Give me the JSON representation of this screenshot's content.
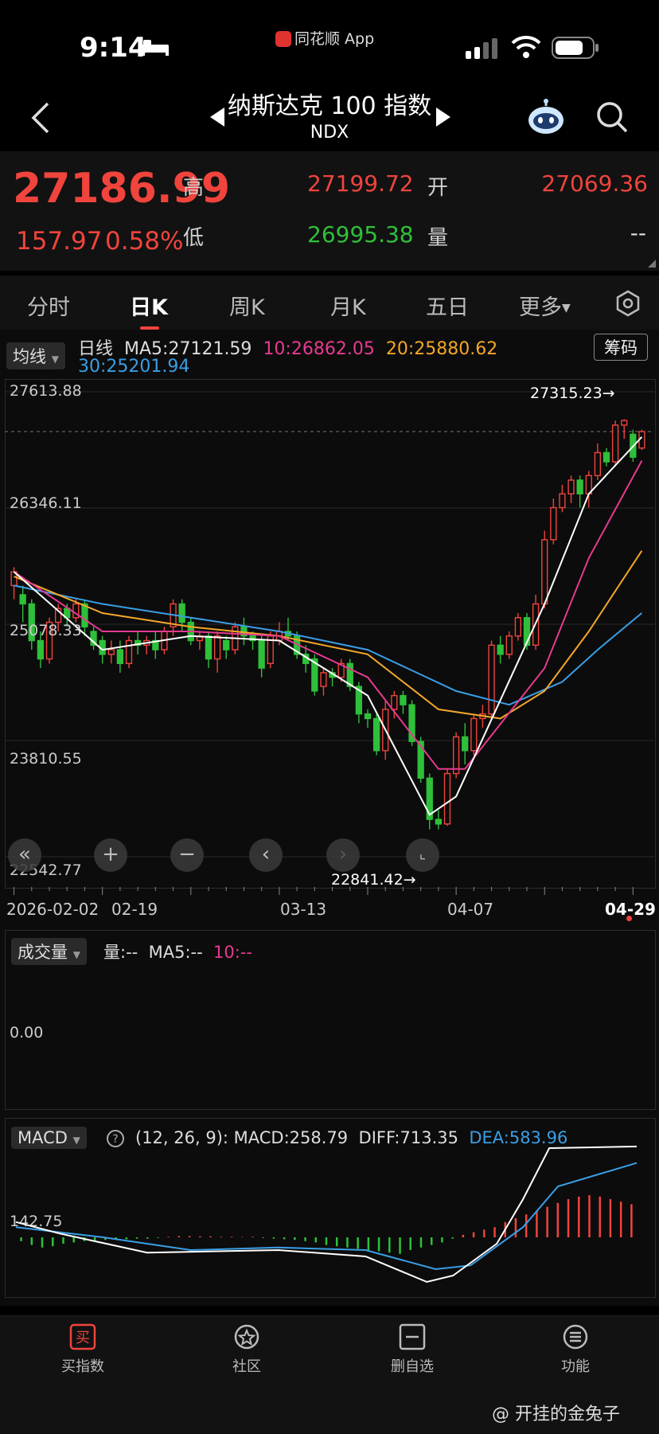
{
  "status": {
    "time": "9:14",
    "app_label": "同花顺 App"
  },
  "header": {
    "title": "纳斯达克 100 指数",
    "subtitle": "NDX"
  },
  "quote": {
    "price": "27186.99",
    "change": "157.97",
    "change_pct": "0.58%",
    "high_label": "高",
    "high": "27199.72",
    "low_label": "低",
    "low": "26995.38",
    "open_label": "开",
    "open": "27069.36",
    "volume_label": "量",
    "volume": "--"
  },
  "tabs": [
    "分时",
    "日K",
    "周K",
    "月K",
    "五日",
    "更多"
  ],
  "active_tab": 1,
  "main_chart": {
    "ma_selector": "均线",
    "legend_prefix": "日线",
    "ma5": "MA5:27121.59",
    "ma10": "10:26862.05",
    "ma20": "20:25880.62",
    "ma30": "30:25201.94",
    "chips_button": "筹码",
    "y_labels": [
      "27613.88",
      "26346.11",
      "25078.33",
      "23810.55",
      "22542.77"
    ],
    "high_marker": "27315.23→",
    "low_marker": "22841.42→",
    "x_labels": [
      "2026-02-02",
      "02-19",
      "03-13",
      "04-07",
      "04-29"
    ],
    "colors": {
      "ma5": "#ffffff",
      "ma10": "#e63a8f",
      "ma20": "#f4a62a",
      "ma30": "#3a9ee6",
      "up": "#f0443d",
      "down": "#2ec03a"
    }
  },
  "volume_panel": {
    "selector": "成交量",
    "vol": "量:--",
    "ma5": "MA5:--",
    "ma10": "10:--",
    "zero": "0.00"
  },
  "macd_panel": {
    "selector": "MACD",
    "params": "(12, 26, 9):",
    "macd": "MACD:258.79",
    "diff": "DIFF:713.35",
    "dea": "DEA:583.96",
    "level": "142.75"
  },
  "bottom_nav": [
    "买指数",
    "社区",
    "删自选",
    "功能"
  ],
  "watermark": "@ 开挂的金兔子",
  "chart_data": {
    "type": "candlestick",
    "x_start": "2026-02-02",
    "x_end": "04-29",
    "ylim": [
      22542.77,
      27613.88
    ],
    "high": 27315.23,
    "low": 22841.42,
    "candles": [
      [
        25500,
        25650,
        25350,
        25700
      ],
      [
        25400,
        25300,
        25100,
        25500
      ],
      [
        25300,
        24900,
        24800,
        25350
      ],
      [
        24900,
        24700,
        24600,
        25000
      ],
      [
        24700,
        25100,
        24650,
        25150
      ],
      [
        25100,
        25250,
        25000,
        25300
      ],
      [
        25250,
        25150,
        25050,
        25300
      ],
      [
        25150,
        25300,
        25100,
        25350
      ],
      [
        25300,
        25050,
        24950,
        25350
      ],
      [
        25000,
        24850,
        24800,
        25050
      ],
      [
        24900,
        24750,
        24650,
        24950
      ],
      [
        24750,
        24800,
        24650,
        24900
      ],
      [
        24800,
        24650,
        24550,
        24900
      ],
      [
        24650,
        24900,
        24600,
        24950
      ],
      [
        24900,
        24850,
        24750,
        25000
      ],
      [
        24850,
        24900,
        24750,
        24950
      ],
      [
        24900,
        24800,
        24700,
        25000
      ],
      [
        24800,
        25000,
        24750,
        25050
      ],
      [
        25050,
        25300,
        24950,
        25350
      ],
      [
        25300,
        25100,
        25000,
        25350
      ],
      [
        25100,
        24900,
        24850,
        25150
      ],
      [
        24900,
        24950,
        24800,
        25000
      ],
      [
        24950,
        24700,
        24600,
        25000
      ],
      [
        24700,
        24950,
        24550,
        25000
      ],
      [
        24900,
        24800,
        24700,
        24950
      ],
      [
        24800,
        25050,
        24750,
        25100
      ],
      [
        25050,
        24950,
        24850,
        25150
      ],
      [
        24950,
        24900,
        24800,
        25000
      ],
      [
        24900,
        24600,
        24500,
        24950
      ],
      [
        24650,
        24950,
        24600,
        25000
      ],
      [
        24900,
        25000,
        24850,
        25100
      ],
      [
        25000,
        24950,
        24900,
        25150
      ],
      [
        24950,
        24750,
        24700,
        25000
      ],
      [
        24750,
        24650,
        24550,
        24850
      ],
      [
        24700,
        24350,
        24300,
        24750
      ],
      [
        24400,
        24550,
        24300,
        24600
      ],
      [
        24550,
        24500,
        24400,
        24600
      ],
      [
        24500,
        24650,
        24450,
        24700
      ],
      [
        24650,
        24400,
        24350,
        24700
      ],
      [
        24400,
        24100,
        24000,
        24450
      ],
      [
        24100,
        24050,
        23950,
        24150
      ],
      [
        24050,
        23700,
        23650,
        24100
      ],
      [
        23700,
        24150,
        23600,
        24250
      ],
      [
        24150,
        24300,
        24050,
        24350
      ],
      [
        24300,
        24200,
        24100,
        24350
      ],
      [
        24200,
        23800,
        23750,
        24250
      ],
      [
        23800,
        23400,
        23350,
        23850
      ],
      [
        23400,
        22950,
        22840,
        23450
      ],
      [
        22950,
        22900,
        22842,
        23050
      ],
      [
        22900,
        23450,
        22880,
        23500
      ],
      [
        23450,
        23850,
        23400,
        23900
      ],
      [
        23850,
        23700,
        23550,
        24000
      ],
      [
        23700,
        24050,
        23650,
        24100
      ],
      [
        24050,
        24100,
        23950,
        24200
      ],
      [
        24100,
        24850,
        24050,
        24900
      ],
      [
        24850,
        24750,
        24650,
        24950
      ],
      [
        24750,
        24950,
        24700,
        25000
      ],
      [
        24950,
        25150,
        24900,
        25200
      ],
      [
        25150,
        24850,
        24800,
        25200
      ],
      [
        24850,
        25300,
        24800,
        25400
      ],
      [
        25300,
        26000,
        25250,
        26100
      ],
      [
        26000,
        26350,
        25950,
        26450
      ],
      [
        26350,
        26500,
        26300,
        26600
      ],
      [
        26500,
        26650,
        26400,
        26700
      ],
      [
        26650,
        26500,
        26350,
        26700
      ],
      [
        26500,
        26700,
        26350,
        26750
      ],
      [
        26700,
        26950,
        26650,
        27050
      ],
      [
        26950,
        26850,
        26800,
        27000
      ],
      [
        26850,
        27250,
        26800,
        27300
      ],
      [
        27250,
        27300,
        27100,
        27315
      ],
      [
        27150,
        26900,
        26850,
        27200
      ],
      [
        27000,
        27180,
        26980,
        27200
      ]
    ],
    "ma_lines": {
      "ma5": [
        [
          0,
          25650
        ],
        [
          10,
          24800
        ],
        [
          20,
          24950
        ],
        [
          30,
          24900
        ],
        [
          40,
          24300
        ],
        [
          47,
          23000
        ],
        [
          50,
          23200
        ],
        [
          60,
          25300
        ],
        [
          65,
          26500
        ],
        [
          71,
          27121
        ]
      ],
      "ma10": [
        [
          0,
          25650
        ],
        [
          10,
          25000
        ],
        [
          20,
          25000
        ],
        [
          30,
          24950
        ],
        [
          40,
          24500
        ],
        [
          48,
          23500
        ],
        [
          51,
          23500
        ],
        [
          60,
          24600
        ],
        [
          65,
          25800
        ],
        [
          71,
          26862
        ]
      ],
      "ma20": [
        [
          0,
          25600
        ],
        [
          10,
          25200
        ],
        [
          20,
          25050
        ],
        [
          30,
          24950
        ],
        [
          40,
          24750
        ],
        [
          48,
          24150
        ],
        [
          55,
          24050
        ],
        [
          60,
          24350
        ],
        [
          65,
          25000
        ],
        [
          71,
          25880
        ]
      ],
      "ma30": [
        [
          0,
          25500
        ],
        [
          10,
          25300
        ],
        [
          20,
          25150
        ],
        [
          30,
          25000
        ],
        [
          40,
          24800
        ],
        [
          50,
          24350
        ],
        [
          56,
          24200
        ],
        [
          62,
          24450
        ],
        [
          66,
          24800
        ],
        [
          71,
          25201
        ]
      ]
    },
    "macd_histogram": [
      -30,
      -60,
      -80,
      -70,
      -50,
      -40,
      -30,
      -25,
      -20,
      -20,
      -15,
      -10,
      -10,
      -5,
      5,
      10,
      10,
      8,
      8,
      5,
      5,
      3,
      5,
      -5,
      -10,
      -15,
      -20,
      -30,
      -40,
      -60,
      -70,
      -80,
      -90,
      -100,
      -110,
      -120,
      -130,
      -100,
      -80,
      -60,
      -40,
      -10,
      20,
      40,
      60,
      80,
      120,
      150,
      180,
      210,
      240,
      270,
      300,
      320,
      330,
      320,
      300,
      280,
      260
    ],
    "diff_line": [
      [
        0,
        120
      ],
      [
        5,
        30
      ],
      [
        15,
        -120
      ],
      [
        30,
        -100
      ],
      [
        40,
        -150
      ],
      [
        47,
        -350
      ],
      [
        50,
        -300
      ],
      [
        55,
        -50
      ],
      [
        58,
        300
      ],
      [
        61,
        700
      ],
      [
        71,
        713
      ]
    ],
    "dea_line": [
      [
        0,
        80
      ],
      [
        10,
        0
      ],
      [
        20,
        -100
      ],
      [
        30,
        -80
      ],
      [
        40,
        -100
      ],
      [
        48,
        -250
      ],
      [
        52,
        -220
      ],
      [
        58,
        80
      ],
      [
        62,
        400
      ],
      [
        71,
        584
      ]
    ]
  }
}
